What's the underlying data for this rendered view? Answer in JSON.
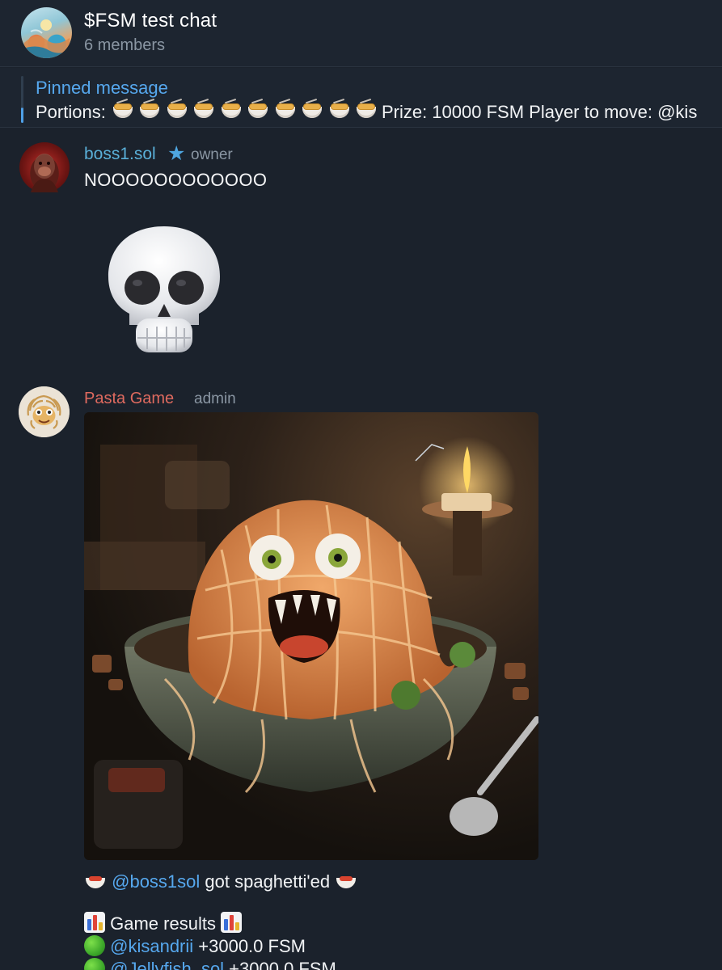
{
  "header": {
    "title": "$FSM test chat",
    "subtitle": "6 members",
    "avatar_icon": "group-avatar-icon"
  },
  "pinned": {
    "title": "Pinned message",
    "text_prefix": "Portions:",
    "portions_count": 10,
    "portion_icon": "spaghetti-bowl-icon",
    "text_suffix": "Prize: 10000 FSM Player to move: @kis"
  },
  "messages": [
    {
      "sender": "boss1.sol",
      "badge_icon": "star-icon",
      "role": "owner",
      "text": "NOOOOOOOOOOOO",
      "sticker_icon": "skull-emoji-icon"
    },
    {
      "sender": "Pasta Game",
      "role": "admin",
      "photo_icon": "spaghetti-monster-photo",
      "caption_line1": {
        "mention": "@boss1sol",
        "text": " got spaghetti'ed "
      },
      "caption_line2": "Game results",
      "results": [
        {
          "mention": "@kisandrii",
          "value": " +3000.0 FSM"
        },
        {
          "mention": "@Jellyfish_sol",
          "value": " +3000.0 FSM"
        }
      ]
    }
  ],
  "colors": {
    "background": "#1b222c",
    "accent_link": "#56a8ee",
    "boss_name": "#5ab0d9",
    "pasta_name": "#df6a5f",
    "muted": "#8a96a3"
  }
}
